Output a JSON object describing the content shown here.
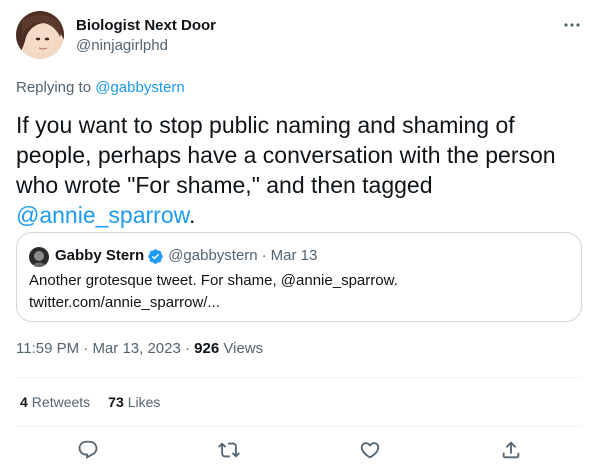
{
  "author": {
    "display_name": "Biologist Next Door",
    "handle": "@ninjagirlphd"
  },
  "reply": {
    "prefix": "Replying to",
    "mention": "@gabbystern"
  },
  "tweet": {
    "text_main": "If you want to stop public naming and shaming of people, perhaps have a conversation with the person who wrote \"For shame,\" and then tagged",
    "mention": "@annie_sparrow",
    "text_end": "."
  },
  "quote": {
    "display_name": "Gabby Stern",
    "handle": "@gabbystern",
    "separator": "·",
    "date": "Mar 13",
    "text_line1": "Another grotesque tweet. For shame, @annie_sparrow.",
    "text_line2": "twitter.com/annie_sparrow/..."
  },
  "meta": {
    "time": "11:59 PM",
    "separator1": "·",
    "date": "Mar 13, 2023",
    "separator2": "·",
    "views_count": "926",
    "views_label": "Views"
  },
  "stats": {
    "retweets_count": "4",
    "retweets_label": "Retweets",
    "likes_count": "73",
    "likes_label": "Likes"
  },
  "icons": {
    "more": "more-horizontal-icon",
    "reply": "reply-icon",
    "retweet": "retweet-icon",
    "like": "heart-icon",
    "share": "share-icon",
    "verified": "verified-badge-icon"
  },
  "colors": {
    "link": "#1d9bf0",
    "text": "#0f1419",
    "secondary": "#536471",
    "border": "#cfd9de"
  }
}
